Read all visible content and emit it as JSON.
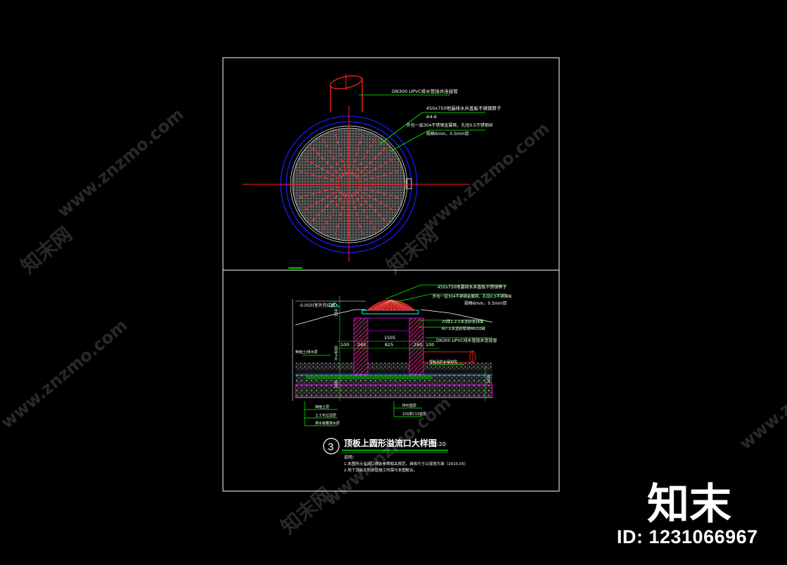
{
  "plan": {
    "pipe_label": "DN300 UPVC排水管接井连接管",
    "grate_label": "450x750地漏排水井盖板不锈钢箅子",
    "grate_sub": "A4-6",
    "mesh_label": "外包一层304不锈钢金属网，孔径0.5不锈钢丝",
    "mesh_sub": "规格6mm，0.5mm厚"
  },
  "section": {
    "grate_label": "450x750地漏排水井盖板不锈钢箅子",
    "mesh_label": "外包一层304不锈钢金属网，孔径0.5不锈钢丝",
    "mesh_sub": "规格6mm，0.5mm厚",
    "elev_label": "-0.050(室外完成面)",
    "mortar_label": "20厚1:2.5水泥砂浆抹面",
    "wall_label": "M7.5水泥砂浆砌MU10砖",
    "pipe_label": "DN300 UPVC排水管接井连接管",
    "dim_1505": "1505",
    "dim_240_l": "240",
    "dim_825": "825",
    "dim_240_r": "240",
    "dim_100_l": "100",
    "dim_100_r": "100",
    "side_left_label": "种植土/排水层",
    "side_right_label": "顶板及防水保护层",
    "soil_label": "种植土层",
    "filter_label": "土工布过滤层",
    "drain_label": "排水板蓄排水层",
    "gravel_label": "碎石垫层",
    "concrete_label": "100厚C15垫层",
    "v_dim_top": "150",
    "v_dim_mid": "H=600",
    "v_dim_bot": "100",
    "v_dim_right": "100"
  },
  "title": {
    "number": "3",
    "text": "顶板上圆形溢流口大样图",
    "scale": "1:20",
    "notes_head": "说明：",
    "note1": "1.本图所示溢流口做法参照相关规范，具体尺寸以现场为准（2015.05）",
    "note2": "2.地下顶板及防水层施工时需与本图配合。"
  },
  "watermark": {
    "site": "www.znzmo.com",
    "brand": "知末网",
    "logo": "知末",
    "id": "ID: 1231066967"
  },
  "colors": {
    "background": "#000000",
    "frame": "#ffffff",
    "pipe": "#ff2020",
    "ring": "#1a1aff",
    "grate": "#e02020",
    "text_white": "#ffffff",
    "leader_green": "#00ff00",
    "magenta": "#ff00ff",
    "cyan": "#00ffff",
    "yellow": "#ffff00"
  }
}
